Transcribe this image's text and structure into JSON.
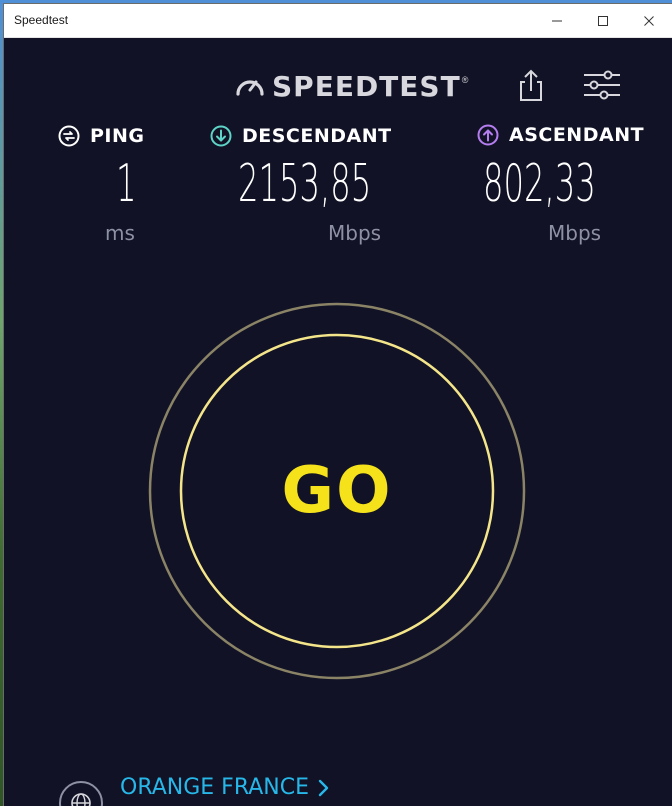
{
  "window": {
    "title": "Speedtest"
  },
  "header": {
    "brand_name": "SPEEDTEST",
    "brand_mark": "®",
    "share_icon": "share-icon",
    "settings_icon": "sliders-icon"
  },
  "metrics": {
    "ping": {
      "label": "PING",
      "value": "1",
      "unit": "ms",
      "icon": "ping-icon"
    },
    "download": {
      "label": "DESCENDANT",
      "value": "2153,85",
      "unit": "Mbps",
      "icon": "download-arrow-icon",
      "color": "#5ed3c7"
    },
    "upload": {
      "label": "ASCENDANT",
      "value": "802,33",
      "unit": "Mbps",
      "icon": "upload-arrow-icon",
      "color": "#b57ef0"
    }
  },
  "go_button": {
    "label": "GO",
    "color": "#f5e21b",
    "ring_color": "#f4e58a",
    "outer_ring_color": "#8a8366"
  },
  "provider": {
    "name": "ORANGE FRANCE",
    "icon": "globe-icon",
    "color": "#27b7e8"
  },
  "colors": {
    "background": "#111225",
    "text": "#ffffff",
    "muted": "#8e90a3"
  }
}
